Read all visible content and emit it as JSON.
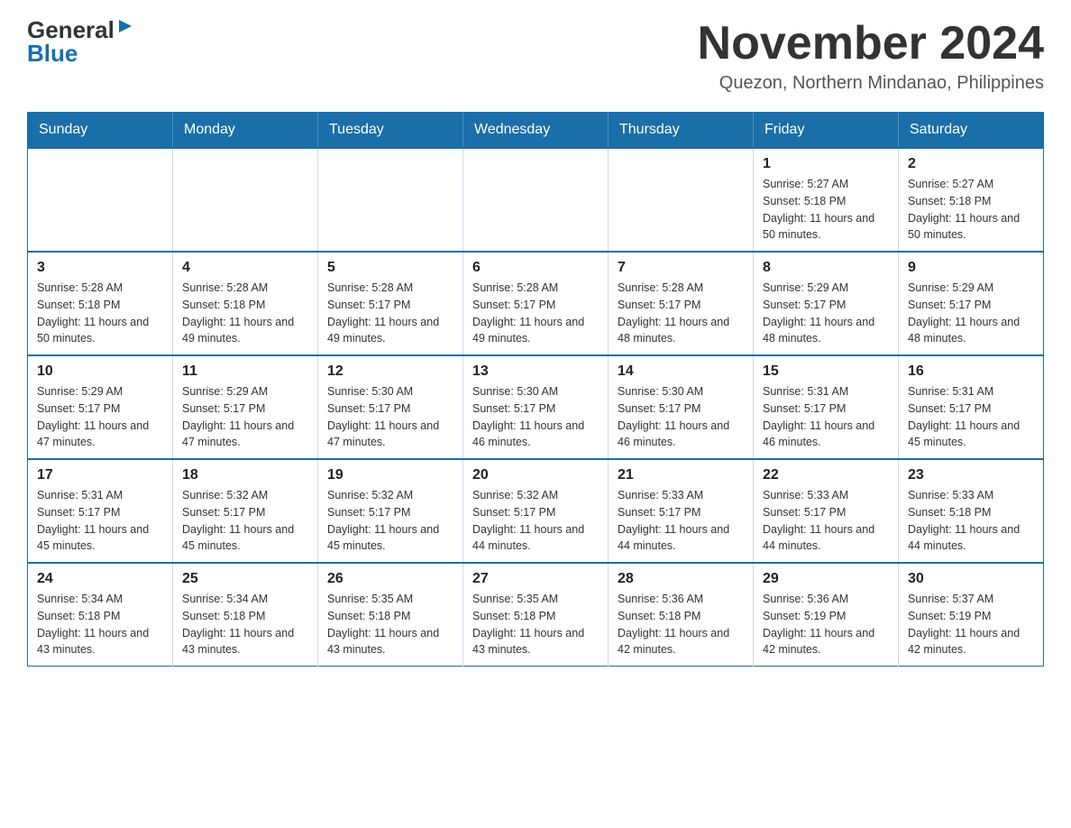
{
  "header": {
    "logo_general": "General",
    "logo_blue": "Blue",
    "month_title": "November 2024",
    "location": "Quezon, Northern Mindanao, Philippines"
  },
  "calendar": {
    "days_of_week": [
      "Sunday",
      "Monday",
      "Tuesday",
      "Wednesday",
      "Thursday",
      "Friday",
      "Saturday"
    ],
    "weeks": [
      {
        "days": [
          {
            "number": "",
            "info": ""
          },
          {
            "number": "",
            "info": ""
          },
          {
            "number": "",
            "info": ""
          },
          {
            "number": "",
            "info": ""
          },
          {
            "number": "",
            "info": ""
          },
          {
            "number": "1",
            "info": "Sunrise: 5:27 AM\nSunset: 5:18 PM\nDaylight: 11 hours\nand 50 minutes."
          },
          {
            "number": "2",
            "info": "Sunrise: 5:27 AM\nSunset: 5:18 PM\nDaylight: 11 hours\nand 50 minutes."
          }
        ]
      },
      {
        "days": [
          {
            "number": "3",
            "info": "Sunrise: 5:28 AM\nSunset: 5:18 PM\nDaylight: 11 hours\nand 50 minutes."
          },
          {
            "number": "4",
            "info": "Sunrise: 5:28 AM\nSunset: 5:18 PM\nDaylight: 11 hours\nand 49 minutes."
          },
          {
            "number": "5",
            "info": "Sunrise: 5:28 AM\nSunset: 5:17 PM\nDaylight: 11 hours\nand 49 minutes."
          },
          {
            "number": "6",
            "info": "Sunrise: 5:28 AM\nSunset: 5:17 PM\nDaylight: 11 hours\nand 49 minutes."
          },
          {
            "number": "7",
            "info": "Sunrise: 5:28 AM\nSunset: 5:17 PM\nDaylight: 11 hours\nand 48 minutes."
          },
          {
            "number": "8",
            "info": "Sunrise: 5:29 AM\nSunset: 5:17 PM\nDaylight: 11 hours\nand 48 minutes."
          },
          {
            "number": "9",
            "info": "Sunrise: 5:29 AM\nSunset: 5:17 PM\nDaylight: 11 hours\nand 48 minutes."
          }
        ]
      },
      {
        "days": [
          {
            "number": "10",
            "info": "Sunrise: 5:29 AM\nSunset: 5:17 PM\nDaylight: 11 hours\nand 47 minutes."
          },
          {
            "number": "11",
            "info": "Sunrise: 5:29 AM\nSunset: 5:17 PM\nDaylight: 11 hours\nand 47 minutes."
          },
          {
            "number": "12",
            "info": "Sunrise: 5:30 AM\nSunset: 5:17 PM\nDaylight: 11 hours\nand 47 minutes."
          },
          {
            "number": "13",
            "info": "Sunrise: 5:30 AM\nSunset: 5:17 PM\nDaylight: 11 hours\nand 46 minutes."
          },
          {
            "number": "14",
            "info": "Sunrise: 5:30 AM\nSunset: 5:17 PM\nDaylight: 11 hours\nand 46 minutes."
          },
          {
            "number": "15",
            "info": "Sunrise: 5:31 AM\nSunset: 5:17 PM\nDaylight: 11 hours\nand 46 minutes."
          },
          {
            "number": "16",
            "info": "Sunrise: 5:31 AM\nSunset: 5:17 PM\nDaylight: 11 hours\nand 45 minutes."
          }
        ]
      },
      {
        "days": [
          {
            "number": "17",
            "info": "Sunrise: 5:31 AM\nSunset: 5:17 PM\nDaylight: 11 hours\nand 45 minutes."
          },
          {
            "number": "18",
            "info": "Sunrise: 5:32 AM\nSunset: 5:17 PM\nDaylight: 11 hours\nand 45 minutes."
          },
          {
            "number": "19",
            "info": "Sunrise: 5:32 AM\nSunset: 5:17 PM\nDaylight: 11 hours\nand 45 minutes."
          },
          {
            "number": "20",
            "info": "Sunrise: 5:32 AM\nSunset: 5:17 PM\nDaylight: 11 hours\nand 44 minutes."
          },
          {
            "number": "21",
            "info": "Sunrise: 5:33 AM\nSunset: 5:17 PM\nDaylight: 11 hours\nand 44 minutes."
          },
          {
            "number": "22",
            "info": "Sunrise: 5:33 AM\nSunset: 5:17 PM\nDaylight: 11 hours\nand 44 minutes."
          },
          {
            "number": "23",
            "info": "Sunrise: 5:33 AM\nSunset: 5:18 PM\nDaylight: 11 hours\nand 44 minutes."
          }
        ]
      },
      {
        "days": [
          {
            "number": "24",
            "info": "Sunrise: 5:34 AM\nSunset: 5:18 PM\nDaylight: 11 hours\nand 43 minutes."
          },
          {
            "number": "25",
            "info": "Sunrise: 5:34 AM\nSunset: 5:18 PM\nDaylight: 11 hours\nand 43 minutes."
          },
          {
            "number": "26",
            "info": "Sunrise: 5:35 AM\nSunset: 5:18 PM\nDaylight: 11 hours\nand 43 minutes."
          },
          {
            "number": "27",
            "info": "Sunrise: 5:35 AM\nSunset: 5:18 PM\nDaylight: 11 hours\nand 43 minutes."
          },
          {
            "number": "28",
            "info": "Sunrise: 5:36 AM\nSunset: 5:18 PM\nDaylight: 11 hours\nand 42 minutes."
          },
          {
            "number": "29",
            "info": "Sunrise: 5:36 AM\nSunset: 5:19 PM\nDaylight: 11 hours\nand 42 minutes."
          },
          {
            "number": "30",
            "info": "Sunrise: 5:37 AM\nSunset: 5:19 PM\nDaylight: 11 hours\nand 42 minutes."
          }
        ]
      }
    ]
  }
}
